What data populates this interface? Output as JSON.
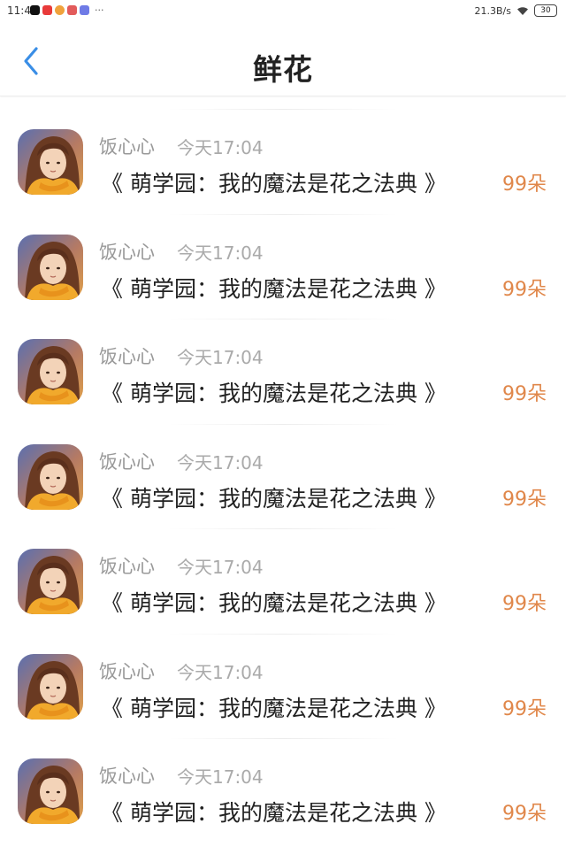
{
  "status_bar": {
    "time": "11:46",
    "net_speed": "21.3B/s",
    "battery": "30",
    "more": "···",
    "app_icons": [
      {
        "name": "tiktok-icon",
        "color": "#111111"
      },
      {
        "name": "red-app-icon",
        "color": "#e83a3a"
      },
      {
        "name": "weibo-icon",
        "color": "#f0a23c"
      },
      {
        "name": "red-app-icon-2",
        "color": "#e25b5b"
      },
      {
        "name": "blue-app-icon",
        "color": "#6f7be6"
      }
    ]
  },
  "header": {
    "title": "鲜花",
    "back_icon": "chevron-left-icon",
    "accent": "#3a8ee6"
  },
  "items": [
    {
      "user": "饭心心",
      "time": "今天17:04",
      "title": "《 萌学园：我的魔法是花之法典 》",
      "count": "99朵"
    },
    {
      "user": "饭心心",
      "time": "今天17:04",
      "title": "《 萌学园：我的魔法是花之法典 》",
      "count": "99朵"
    },
    {
      "user": "饭心心",
      "time": "今天17:04",
      "title": "《 萌学园：我的魔法是花之法典 》",
      "count": "99朵"
    },
    {
      "user": "饭心心",
      "time": "今天17:04",
      "title": "《 萌学园：我的魔法是花之法典 》",
      "count": "99朵"
    },
    {
      "user": "饭心心",
      "time": "今天17:04",
      "title": "《 萌学园：我的魔法是花之法典 》",
      "count": "99朵"
    },
    {
      "user": "饭心心",
      "time": "今天17:04",
      "title": "《 萌学园：我的魔法是花之法典 》",
      "count": "99朵"
    },
    {
      "user": "饭心心",
      "time": "今天17:04",
      "title": "《 萌学园：我的魔法是花之法典 》",
      "count": "99朵"
    }
  ],
  "colors": {
    "count": "#e0874a",
    "username": "#999999",
    "time": "#aaaaaa"
  }
}
